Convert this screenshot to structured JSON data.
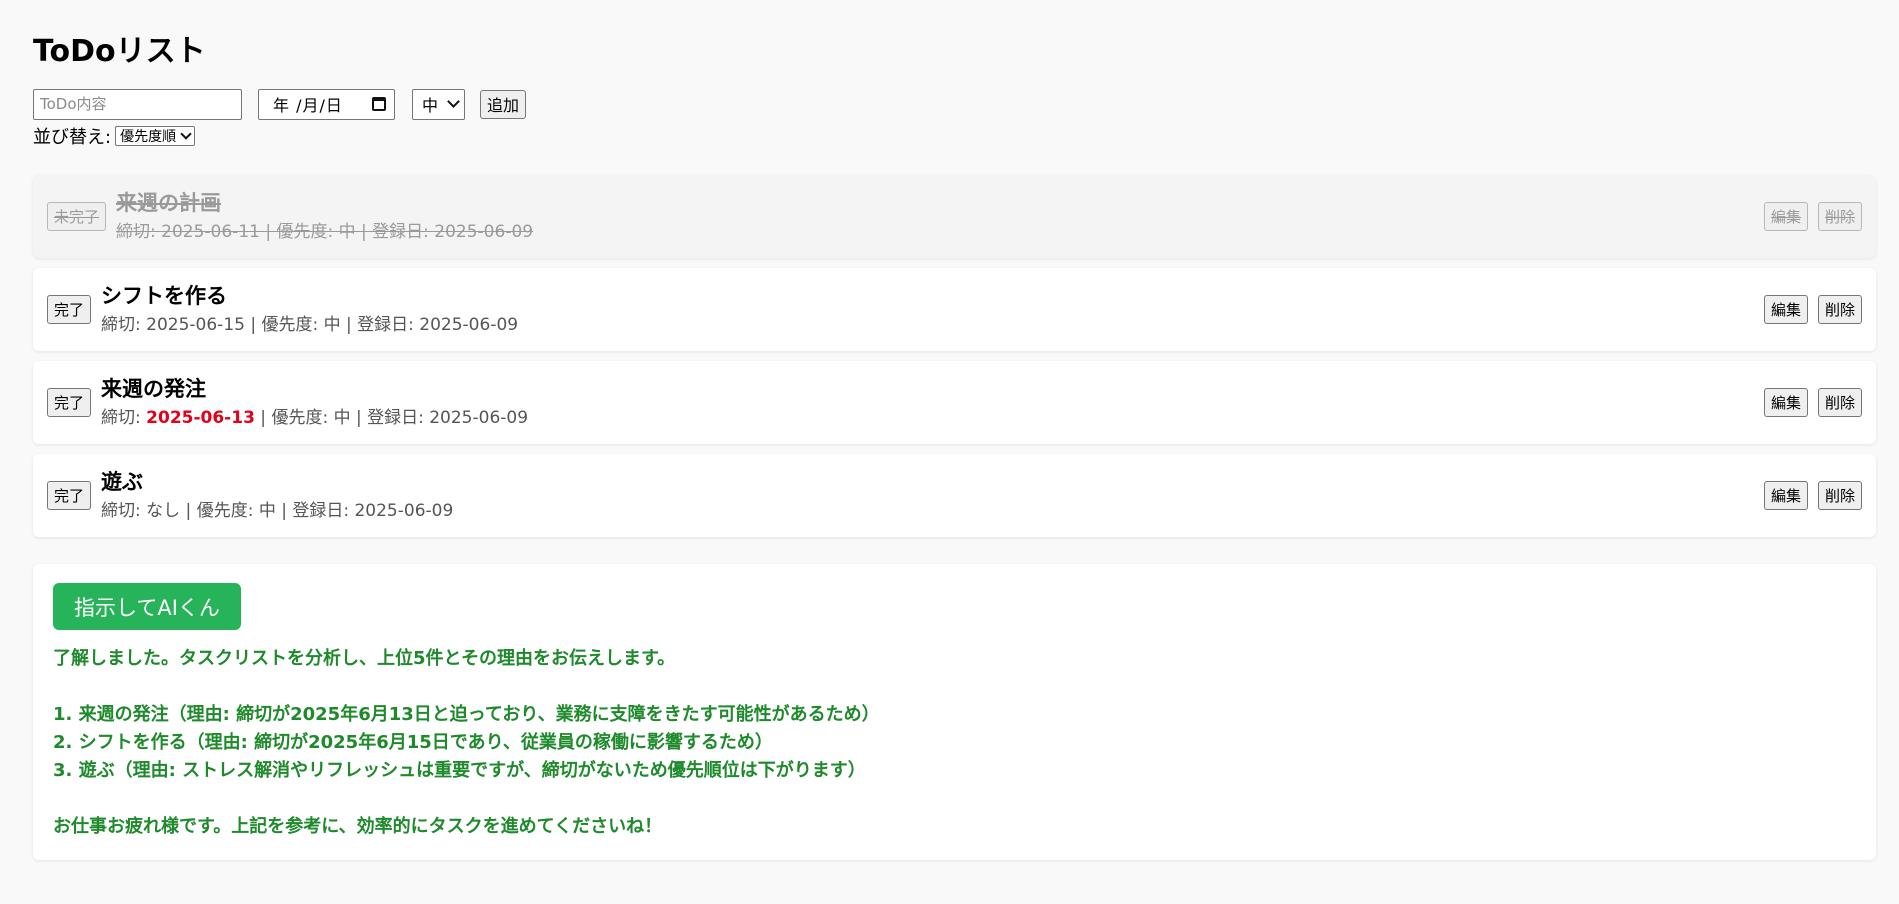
{
  "app": {
    "title": "ToDoリスト"
  },
  "form": {
    "content_placeholder": "ToDo内容",
    "date_placeholder": "年 /月/日",
    "priority_value": "中",
    "add_label": "追加"
  },
  "sort": {
    "label": "並び替え:",
    "value": "優先度順"
  },
  "todos": [
    {
      "status_label": "未完了",
      "title": "来週の計画",
      "meta_deadline_label": "締切: ",
      "deadline": "2025-06-11",
      "meta_rest": " | 優先度: 中 | 登録日: 2025-06-09",
      "edit_label": "編集",
      "delete_label": "削除",
      "done": true,
      "overdue": false
    },
    {
      "status_label": "完了",
      "title": "シフトを作る",
      "meta_deadline_label": "締切: ",
      "deadline": "2025-06-15",
      "meta_rest": " | 優先度: 中 | 登録日: 2025-06-09",
      "edit_label": "編集",
      "delete_label": "削除",
      "done": false,
      "overdue": false
    },
    {
      "status_label": "完了",
      "title": "来週の発注",
      "meta_deadline_label": "締切: ",
      "deadline": "2025-06-13",
      "meta_rest": " | 優先度: 中 | 登録日: 2025-06-09",
      "edit_label": "編集",
      "delete_label": "削除",
      "done": false,
      "overdue": true
    },
    {
      "status_label": "完了",
      "title": "遊ぶ",
      "meta_deadline_label": "締切: ",
      "deadline": "なし",
      "meta_rest": " | 優先度: 中 | 登録日: 2025-06-09",
      "edit_label": "編集",
      "delete_label": "削除",
      "done": false,
      "overdue": false
    }
  ],
  "ai": {
    "button_label": "指示してAIくん",
    "intro": "了解しました。タスクリストを分析し、上位5件とその理由をお伝えします。",
    "items": [
      "1. 来週の発注（理由: 締切が2025年6月13日と迫っており、業務に支障をきたす可能性があるため）",
      "2. シフトを作る（理由: 締切が2025年6月15日であり、従業員の稼働に影響するため）",
      "3. 遊ぶ（理由: ストレス解消やリフレッシュは重要ですが、締切がないため優先順位は下がります）"
    ],
    "closing": "お仕事お疲れ様です。上記を参考に、効率的にタスクを進めてくださいね！"
  },
  "colors": {
    "overdue": "#e3001b",
    "ai_button": "#27b35a",
    "ai_text": "#1f8a2c",
    "background": "#f9f9f9"
  }
}
